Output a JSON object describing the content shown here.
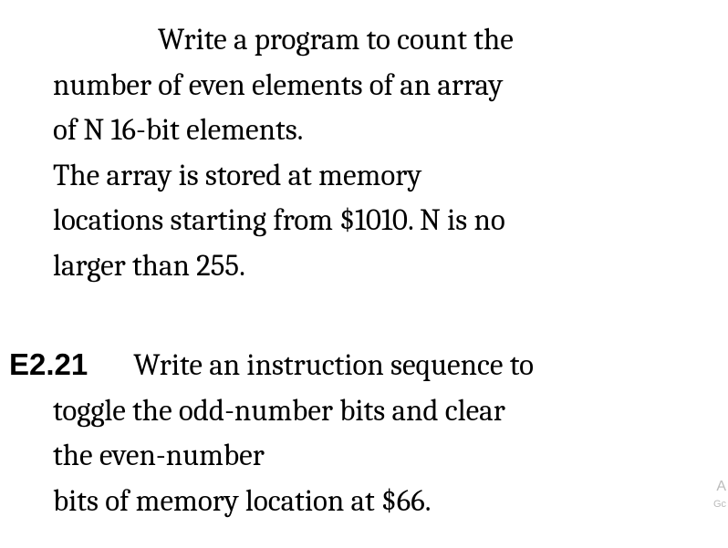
{
  "problem1": {
    "line1": "Write a program to count the",
    "line2": "number of even elements of an array",
    "line3": "of N 16-bit elements.",
    "line4": "The array is stored at memory",
    "line5": "locations starting from $1010. N is no",
    "line6": "larger than 255."
  },
  "problem2": {
    "label": "E2.21",
    "line1": "Write an instruction sequence to",
    "line2": "toggle the odd-number bits and clear",
    "line3": "the even-number",
    "line4": "bits of memory location at $66."
  },
  "watermark": {
    "text1": "A",
    "text2": "Gc"
  }
}
